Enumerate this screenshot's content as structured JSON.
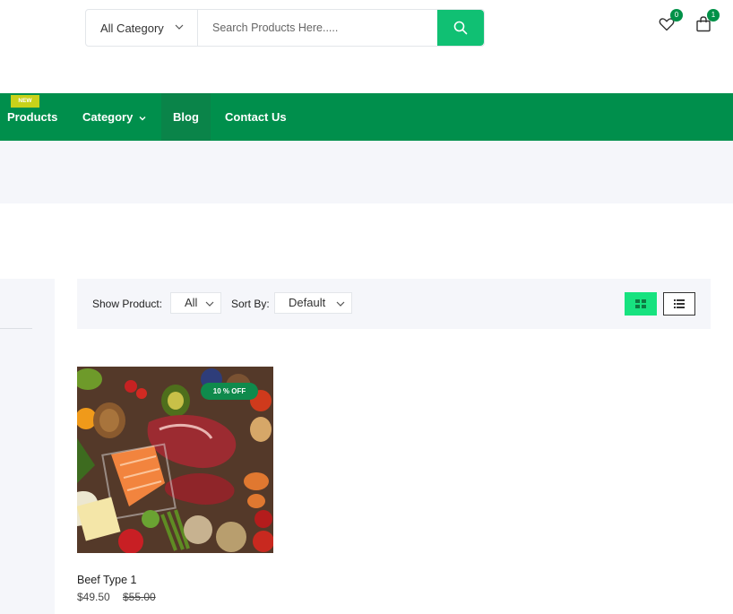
{
  "header": {
    "category_select": "All Category",
    "search_placeholder": "Search Products Here.....",
    "wishlist_count": "0",
    "cart_count": "1"
  },
  "nav": {
    "items": [
      {
        "label": "Products",
        "tag": "NEW"
      },
      {
        "label": "Category"
      },
      {
        "label": "Blog"
      },
      {
        "label": "Contact Us"
      }
    ]
  },
  "toolbar": {
    "show_label": "Show Product:",
    "show_value": "All",
    "sort_label": "Sort By:",
    "sort_value": "Default"
  },
  "products": [
    {
      "name": "Beef Type 1",
      "price": "$49.50",
      "old_price": "$55.00",
      "discount": "10 % OFF"
    }
  ],
  "colors": {
    "brand_green": "#008f4c",
    "accent_green": "#10c073",
    "new_tag": "#c9d21a"
  }
}
